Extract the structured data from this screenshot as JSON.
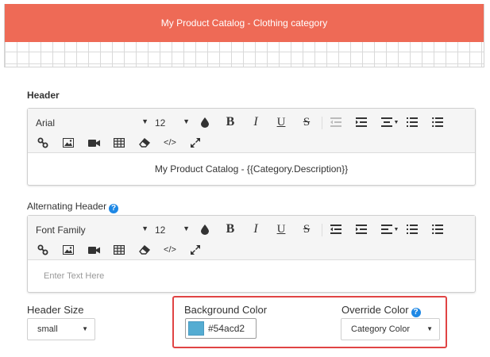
{
  "preview": {
    "banner_text": "My Product Catalog - Clothing category",
    "banner_color": "#ee6a56"
  },
  "header_section": {
    "label": "Header",
    "toolbar": {
      "font": "Arial",
      "size": "12"
    },
    "content": "My Product Catalog - {{Category.Description}}"
  },
  "alt_header_section": {
    "label": "Alternating Header",
    "help": "?",
    "toolbar": {
      "font": "Font Family",
      "size": "12"
    },
    "placeholder": "Enter Text Here"
  },
  "header_size": {
    "label": "Header Size",
    "value": "small"
  },
  "background_color": {
    "label": "Background Color",
    "value": "#54acd2",
    "swatch": "#54acd2"
  },
  "override_color": {
    "label": "Override Color",
    "help": "?",
    "value": "Category Color"
  },
  "icons": {
    "bold": "B",
    "italic": "I",
    "underline": "U",
    "strike": "S",
    "code": "</>"
  }
}
